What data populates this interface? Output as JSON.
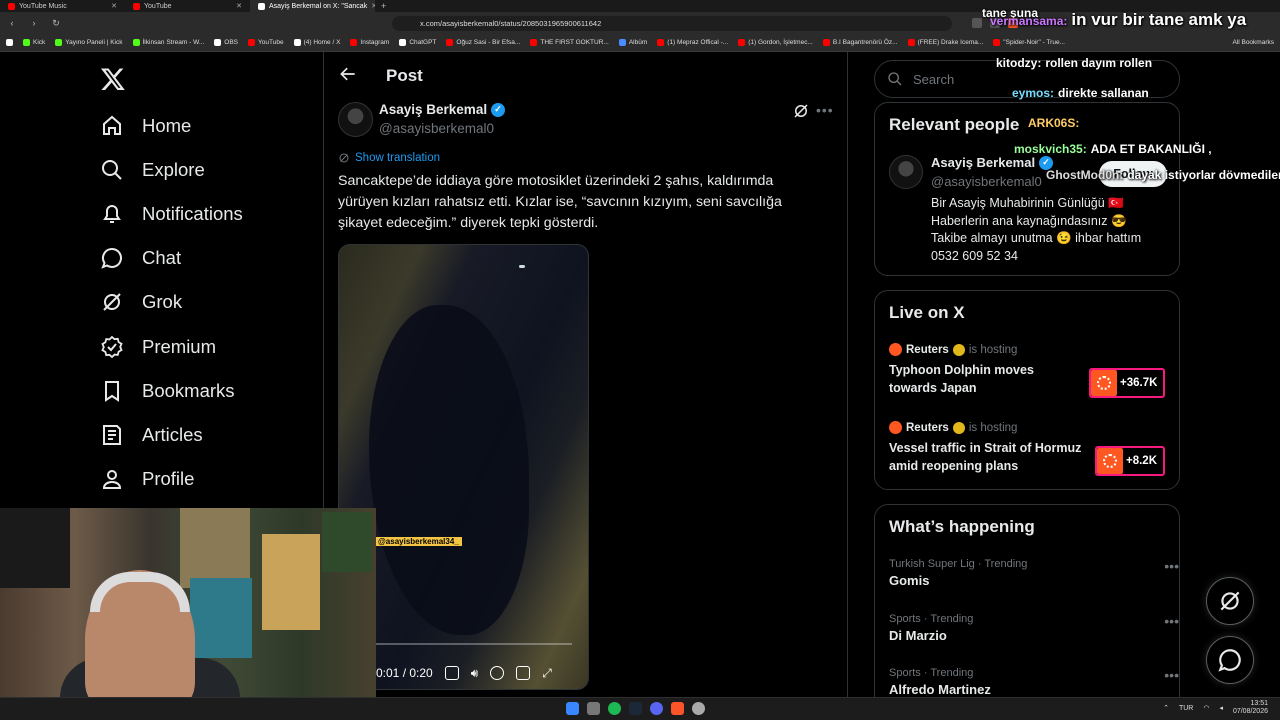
{
  "browser": {
    "tabs": [
      {
        "title": "YouTube Music",
        "fav": "yt"
      },
      {
        "title": "YouTube",
        "fav": "yt"
      },
      {
        "title": "Asayiş Berkemal on X: \"Sancak",
        "fav": "x",
        "active": true
      }
    ],
    "url": "x.com/asayisberkemal0/status/2085031965900611642",
    "bookmarks": [
      "Kick",
      "Yayıno Paneli | Kick",
      "İlkinsan Stream - W...",
      "OBS",
      "YouTube",
      "(4) Home / X",
      "Instagram",
      "ChatGPT",
      "Oğuz Sasi - Bir Efsa...",
      "THE FIRST GOKTUR...",
      "Albüm",
      "(1) Mepraz Offical -...",
      "(1) Gordon, İşletmec...",
      "B.I Bagantrenörü Öz...",
      "(FREE) Drake Icema...",
      "\"Spider-Noir\" - True..."
    ],
    "all_bookmarks": "All Bookmarks"
  },
  "sidebar": {
    "logo": "X",
    "items": [
      {
        "label": "Home",
        "icon": "home-icon"
      },
      {
        "label": "Explore",
        "icon": "search-icon"
      },
      {
        "label": "Notifications",
        "icon": "bell-icon"
      },
      {
        "label": "Chat",
        "icon": "chat-icon"
      },
      {
        "label": "Grok",
        "icon": "grok-icon"
      },
      {
        "label": "Premium",
        "icon": "premium-icon"
      },
      {
        "label": "Bookmarks",
        "icon": "bookmark-icon"
      },
      {
        "label": "Articles",
        "icon": "articles-icon"
      },
      {
        "label": "Profile",
        "icon": "profile-icon"
      }
    ]
  },
  "post": {
    "header_title": "Post",
    "author_name": "Asayiş Berkemal",
    "author_handle": "@asayisberkemal0",
    "show_translation": "Show translation",
    "text": "Sancaktepe’de iddiaya göre motosiklet üzerindeki 2 şahıs, kaldırımda yürüyen kızları rahatsız etti. Kızlar ise, “savcının kızıyım, seni savcılığa şikayet edeceğim.” diyerek tepki gösterdi.",
    "video": {
      "time": "0:01 / 0:20",
      "progress": 0.05,
      "watermark": "@asayisberkemal34_"
    }
  },
  "right": {
    "search_placeholder": "Search",
    "relevant": {
      "title": "Relevant people",
      "name": "Asayiş Berkemal",
      "handle": "@asayisberkemal0",
      "follow": "Follow",
      "bio_lines": [
        "Bir Asayiş Muhabirinin Günlüğü 🇹🇷",
        "Haberlerin ana kaynağındasınız 😎",
        "Takibe almayı unutma 😉 ihbar hattım",
        "0532 609 52 34"
      ]
    },
    "live": {
      "title": "Live on X",
      "items": [
        {
          "host": "Reuters",
          "status": "is hosting",
          "title": "Typhoon Dolphin moves towards Japan",
          "count": "+36.7K"
        },
        {
          "host": "Reuters",
          "status": "is hosting",
          "title": "Vessel traffic in Strait of Hormuz amid reopening plans",
          "count": "+8.2K"
        }
      ]
    },
    "happening": {
      "title": "What’s happening",
      "trends": [
        {
          "category": "Turkish Super Lig · Trending",
          "name": "Gomis"
        },
        {
          "category": "Sports · Trending",
          "name": "Di Marzio"
        },
        {
          "category": "Sports · Trending",
          "name": "Alfredo Martinez"
        }
      ]
    }
  },
  "chat_overlay": [
    {
      "user": "",
      "text": "tane şuna"
    },
    {
      "user": "vermansama:",
      "text": "in vur bir tane amk ya"
    },
    {
      "user": "kitodzy:",
      "text": "rollen dayım rollen"
    },
    {
      "user": "eymos:",
      "text": "direkte sallanan"
    },
    {
      "user": "ARK06S:",
      "text": ""
    },
    {
      "user": "moskvich35:",
      "text": "ADA ET BAKANLIĞI ,"
    },
    {
      "user": "GhostMod0n:",
      "text": "dayak istiyorlar dövmediler"
    }
  ],
  "taskbar": {
    "lang": "TUR",
    "time": "13:51",
    "date": "07/08/2026"
  },
  "colors": {
    "accent": "#1d9bf0",
    "live_border": "#f91880",
    "text": "#e7e9ea",
    "muted": "#71767b"
  }
}
